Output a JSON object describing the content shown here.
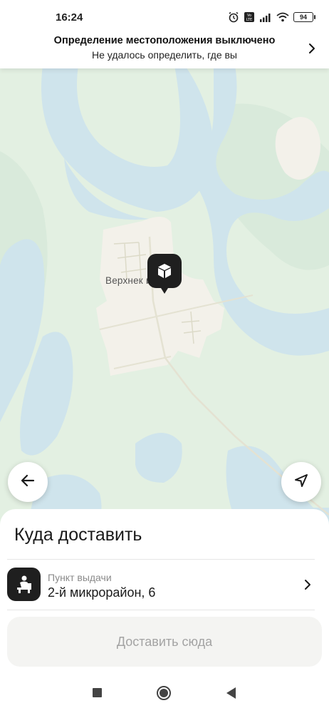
{
  "status_bar": {
    "time": "16:24",
    "battery": "94",
    "icons": [
      "alarm-icon",
      "volte-icon",
      "signal-icon",
      "wifi-icon",
      "battery-icon"
    ]
  },
  "location_banner": {
    "title": "Определение местоположения выключено",
    "subtitle": "Не удалось определить, где вы",
    "icon": "chevron-right-icon"
  },
  "map": {
    "place_label": "Верхнек           ий",
    "pin_icon": "package-icon",
    "colors": {
      "land": "#e3f0e2",
      "water": "#cfe4ec",
      "settlement": "#f3f1ea"
    }
  },
  "controls": {
    "back_icon": "arrow-left-icon",
    "locate_icon": "navigation-arrow-icon"
  },
  "sheet": {
    "title": "Куда доставить",
    "pickup": {
      "label": "Пункт выдачи",
      "address": "2-й микрорайон, 6",
      "icon": "pickup-point-icon"
    },
    "deliver_button": "Доставить сюда"
  },
  "nav_bar": {
    "icons": [
      "recents-square-icon",
      "home-circle-icon",
      "back-triangle-icon"
    ]
  }
}
